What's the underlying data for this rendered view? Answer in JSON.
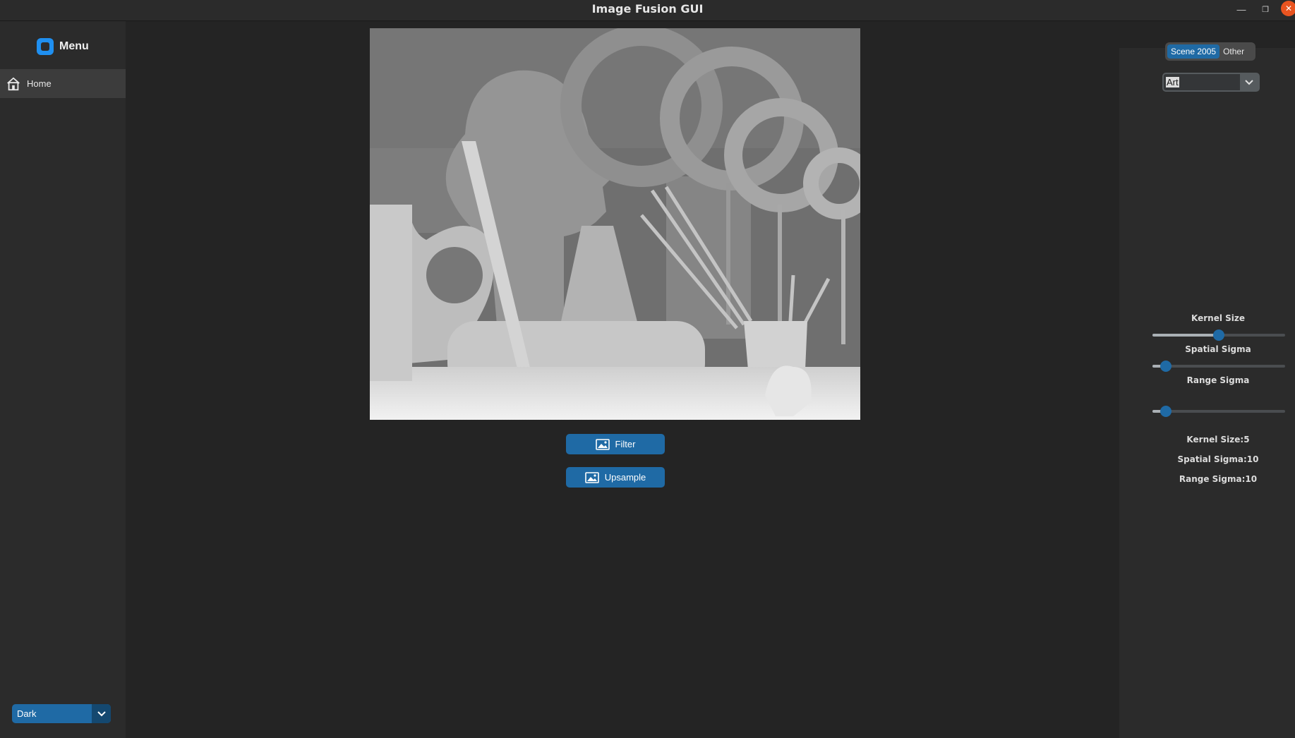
{
  "window": {
    "title": "Image Fusion GUI"
  },
  "sidebar": {
    "brand": "Menu",
    "nav": [
      {
        "label": "Home",
        "icon": "home-icon"
      }
    ],
    "appearance": {
      "value": "Dark"
    }
  },
  "main": {
    "image": {
      "description_icon": "image-icon"
    },
    "buttons": {
      "filter": "Filter",
      "upsample": "Upsample"
    }
  },
  "right_panel": {
    "segmented": {
      "options": [
        "Scene 2005",
        "Other"
      ],
      "selected": "Scene 2005"
    },
    "dataset_combo": {
      "value": "Art"
    },
    "sliders": {
      "kernel_size": {
        "label": "Kernel Size",
        "fraction": 0.5
      },
      "spatial_sigma": {
        "label": "Spatial Sigma",
        "fraction": 0.1
      },
      "range_sigma": {
        "label": "Range Sigma",
        "fraction": 0.1
      }
    },
    "readouts": {
      "kernel_size": "Kernel Size:5",
      "spatial_sigma": "Spatial Sigma:10",
      "range_sigma": "Range Sigma:10"
    }
  },
  "colors": {
    "accent": "#1f6aa5",
    "window_bg": "#242424",
    "panel_bg": "#2b2b2b",
    "close_button": "#e95420"
  }
}
